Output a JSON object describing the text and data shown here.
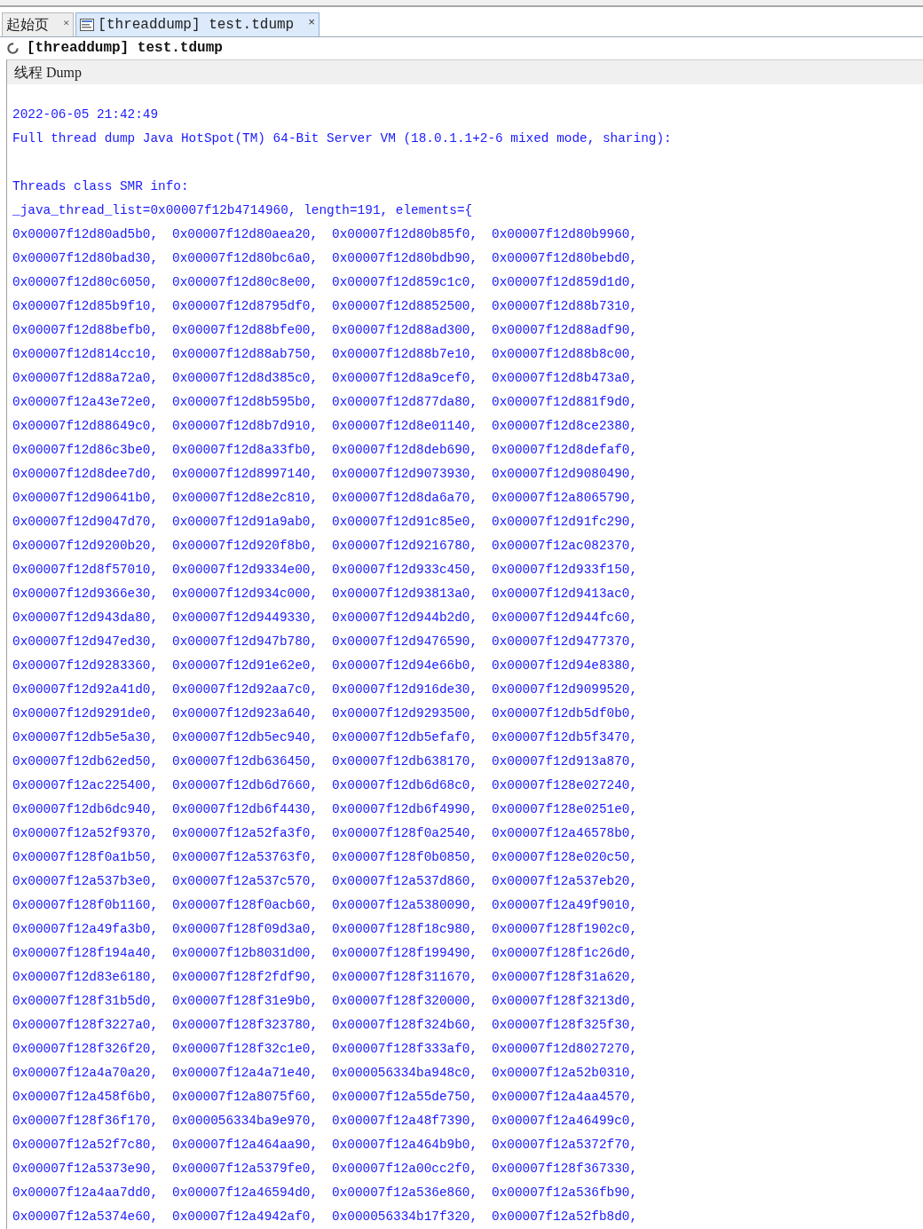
{
  "tabs": [
    {
      "label": "起始页",
      "selected": false,
      "close": "×"
    },
    {
      "label": "[threaddump] test.tdump",
      "selected": true,
      "close": "×"
    }
  ],
  "document": {
    "title": "[threaddump] test.tdump",
    "section": "线程 Dump"
  },
  "header_lines": [
    "2022-06-05 21:42:49",
    "Full thread dump Java HotSpot(TM) 64-Bit Server VM (18.0.1.1+2-6 mixed mode, sharing):"
  ],
  "smr_lines": [
    "Threads class SMR info:",
    "_java_thread_list=0x00007f12b4714960, length=191, elements={"
  ],
  "addresses": [
    [
      "0x00007f12d80ad5b0,",
      "0x00007f12d80aea20,",
      "0x00007f12d80b85f0,",
      "0x00007f12d80b9960,"
    ],
    [
      "0x00007f12d80bad30,",
      "0x00007f12d80bc6a0,",
      "0x00007f12d80bdb90,",
      "0x00007f12d80bebd0,"
    ],
    [
      "0x00007f12d80c6050,",
      "0x00007f12d80c8e00,",
      "0x00007f12d859c1c0,",
      "0x00007f12d859d1d0,"
    ],
    [
      "0x00007f12d85b9f10,",
      "0x00007f12d8795df0,",
      "0x00007f12d8852500,",
      "0x00007f12d88b7310,"
    ],
    [
      "0x00007f12d88befb0,",
      "0x00007f12d88bfe00,",
      "0x00007f12d88ad300,",
      "0x00007f12d88adf90,"
    ],
    [
      "0x00007f12d814cc10,",
      "0x00007f12d88ab750,",
      "0x00007f12d88b7e10,",
      "0x00007f12d88b8c00,"
    ],
    [
      "0x00007f12d88a72a0,",
      "0x00007f12d8d385c0,",
      "0x00007f12d8a9cef0,",
      "0x00007f12d8b473a0,"
    ],
    [
      "0x00007f12a43e72e0,",
      "0x00007f12d8b595b0,",
      "0x00007f12d877da80,",
      "0x00007f12d881f9d0,"
    ],
    [
      "0x00007f12d88649c0,",
      "0x00007f12d8b7d910,",
      "0x00007f12d8e01140,",
      "0x00007f12d8ce2380,"
    ],
    [
      "0x00007f12d86c3be0,",
      "0x00007f12d8a33fb0,",
      "0x00007f12d8deb690,",
      "0x00007f12d8defaf0,"
    ],
    [
      "0x00007f12d8dee7d0,",
      "0x00007f12d8997140,",
      "0x00007f12d9073930,",
      "0x00007f12d9080490,"
    ],
    [
      "0x00007f12d90641b0,",
      "0x00007f12d8e2c810,",
      "0x00007f12d8da6a70,",
      "0x00007f12a8065790,"
    ],
    [
      "0x00007f12d9047d70,",
      "0x00007f12d91a9ab0,",
      "0x00007f12d91c85e0,",
      "0x00007f12d91fc290,"
    ],
    [
      "0x00007f12d9200b20,",
      "0x00007f12d920f8b0,",
      "0x00007f12d9216780,",
      "0x00007f12ac082370,"
    ],
    [
      "0x00007f12d8f57010,",
      "0x00007f12d9334e00,",
      "0x00007f12d933c450,",
      "0x00007f12d933f150,"
    ],
    [
      "0x00007f12d9366e30,",
      "0x00007f12d934c000,",
      "0x00007f12d93813a0,",
      "0x00007f12d9413ac0,"
    ],
    [
      "0x00007f12d943da80,",
      "0x00007f12d9449330,",
      "0x00007f12d944b2d0,",
      "0x00007f12d944fc60,"
    ],
    [
      "0x00007f12d947ed30,",
      "0x00007f12d947b780,",
      "0x00007f12d9476590,",
      "0x00007f12d9477370,"
    ],
    [
      "0x00007f12d9283360,",
      "0x00007f12d91e62e0,",
      "0x00007f12d94e66b0,",
      "0x00007f12d94e8380,"
    ],
    [
      "0x00007f12d92a41d0,",
      "0x00007f12d92aa7c0,",
      "0x00007f12d916de30,",
      "0x00007f12d9099520,"
    ],
    [
      "0x00007f12d9291de0,",
      "0x00007f12d923a640,",
      "0x00007f12d9293500,",
      "0x00007f12db5df0b0,"
    ],
    [
      "0x00007f12db5e5a30,",
      "0x00007f12db5ec940,",
      "0x00007f12db5efaf0,",
      "0x00007f12db5f3470,"
    ],
    [
      "0x00007f12db62ed50,",
      "0x00007f12db636450,",
      "0x00007f12db638170,",
      "0x00007f12d913a870,"
    ],
    [
      "0x00007f12ac225400,",
      "0x00007f12db6d7660,",
      "0x00007f12db6d68c0,",
      "0x00007f128e027240,"
    ],
    [
      "0x00007f12db6dc940,",
      "0x00007f12db6f4430,",
      "0x00007f12db6f4990,",
      "0x00007f128e0251e0,"
    ],
    [
      "0x00007f12a52f9370,",
      "0x00007f12a52fa3f0,",
      "0x00007f128f0a2540,",
      "0x00007f12a46578b0,"
    ],
    [
      "0x00007f128f0a1b50,",
      "0x00007f12a53763f0,",
      "0x00007f128f0b0850,",
      "0x00007f128e020c50,"
    ],
    [
      "0x00007f12a537b3e0,",
      "0x00007f12a537c570,",
      "0x00007f12a537d860,",
      "0x00007f12a537eb20,"
    ],
    [
      "0x00007f128f0b1160,",
      "0x00007f128f0acb60,",
      "0x00007f12a5380090,",
      "0x00007f12a49f9010,"
    ],
    [
      "0x00007f12a49fa3b0,",
      "0x00007f128f09d3a0,",
      "0x00007f128f18c980,",
      "0x00007f128f1902c0,"
    ],
    [
      "0x00007f128f194a40,",
      "0x00007f12b8031d00,",
      "0x00007f128f199490,",
      "0x00007f128f1c26d0,"
    ],
    [
      "0x00007f12d83e6180,",
      "0x00007f128f2fdf90,",
      "0x00007f128f311670,",
      "0x00007f128f31a620,"
    ],
    [
      "0x00007f128f31b5d0,",
      "0x00007f128f31e9b0,",
      "0x00007f128f320000,",
      "0x00007f128f3213d0,"
    ],
    [
      "0x00007f128f3227a0,",
      "0x00007f128f323780,",
      "0x00007f128f324b60,",
      "0x00007f128f325f30,"
    ],
    [
      "0x00007f128f326f20,",
      "0x00007f128f32c1e0,",
      "0x00007f128f333af0,",
      "0x00007f12d8027270,"
    ],
    [
      "0x00007f12a4a70a20,",
      "0x00007f12a4a71e40,",
      "0x000056334ba948c0,",
      "0x00007f12a52b0310,"
    ],
    [
      "0x00007f12a458f6b0,",
      "0x00007f12a8075f60,",
      "0x00007f12a55de750,",
      "0x00007f12a4aa4570,"
    ],
    [
      "0x00007f128f36f170,",
      "0x000056334ba9e970,",
      "0x00007f12a48f7390,",
      "0x00007f12a46499c0,"
    ],
    [
      "0x00007f12a52f7c80,",
      "0x00007f12a464aa90,",
      "0x00007f12a464b9b0,",
      "0x00007f12a5372f70,"
    ],
    [
      "0x00007f12a5373e90,",
      "0x00007f12a5379fe0,",
      "0x00007f12a00cc2f0,",
      "0x00007f128f367330,"
    ],
    [
      "0x00007f12a4aa7dd0,",
      "0x00007f12a46594d0,",
      "0x00007f12a536e860,",
      "0x00007f12a536fb90,"
    ],
    [
      "0x00007f12a5374e60,",
      "0x00007f12a4942af0,",
      "0x000056334b17f320,",
      "0x00007f12a52fb8d0,"
    ]
  ]
}
